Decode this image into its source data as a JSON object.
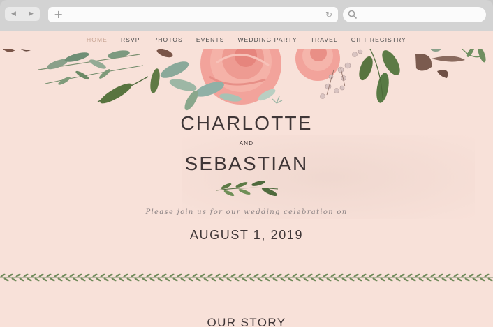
{
  "browser": {
    "back_glyph": "◀",
    "forward_glyph": "▶",
    "new_tab_glyph": "+",
    "reload_glyph": "↻",
    "icons": [
      "back-arrow-icon",
      "forward-arrow-icon",
      "plus-icon",
      "reload-icon",
      "search-icon"
    ]
  },
  "nav": {
    "items": [
      {
        "label": "HOME",
        "active": true
      },
      {
        "label": "RSVP"
      },
      {
        "label": "PHOTOS"
      },
      {
        "label": "EVENTS"
      },
      {
        "label": "WEDDING PARTY"
      },
      {
        "label": "TRAVEL"
      },
      {
        "label": "GIFT REGISTRY"
      }
    ]
  },
  "hero": {
    "name1": "CHARLOTTE",
    "and": "AND",
    "name2": "SEBASTIAN",
    "invite": "Please join us for our wedding celebration on",
    "date": "AUGUST 1, 2019"
  },
  "section": {
    "title": "OUR STORY"
  },
  "colors": {
    "page_bg": "#f8e1d9",
    "text_dark": "#3f3637",
    "nav_active": "#c8a493",
    "leaf_green": "#5f7a4c",
    "rose_pink": "#f2a39b"
  }
}
